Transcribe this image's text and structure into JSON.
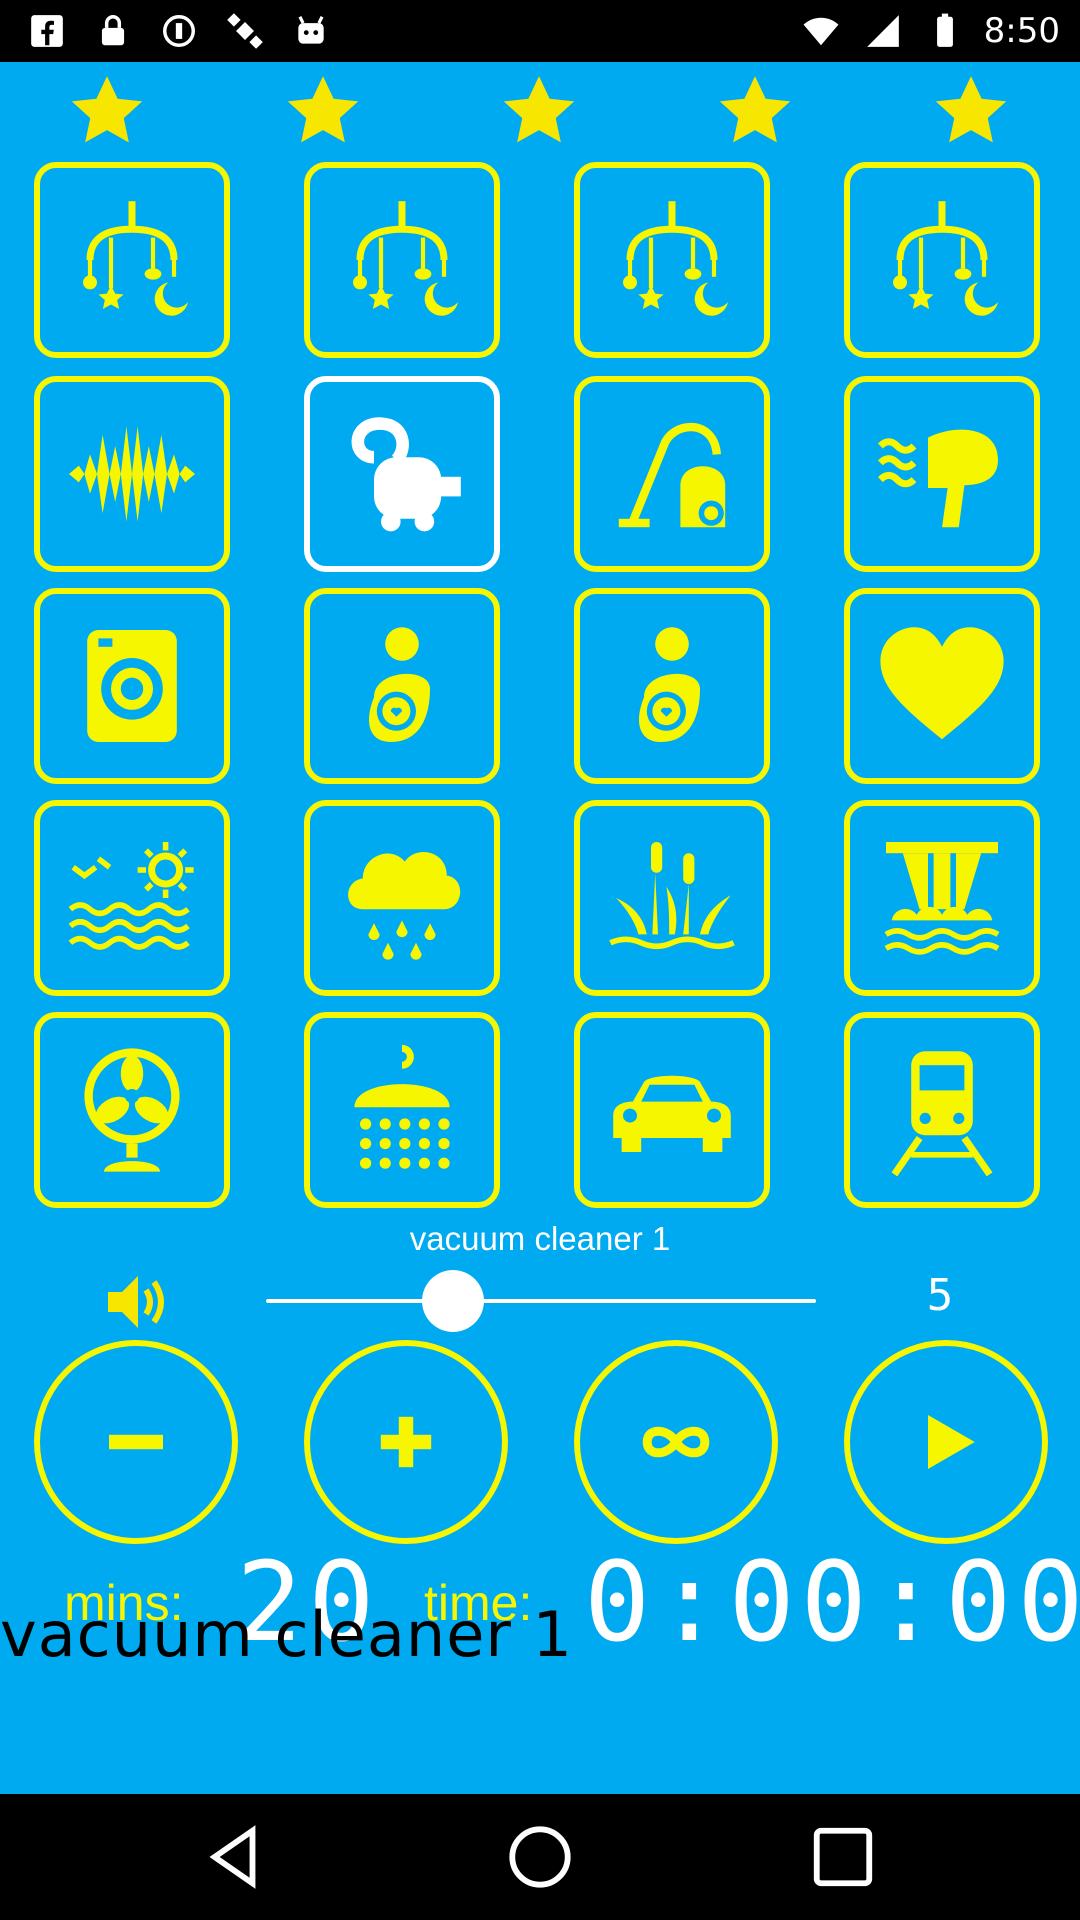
{
  "status_bar": {
    "time": "8:50",
    "icons": [
      "facebook-icon",
      "lock-icon",
      "sync-icon",
      "satellite-icon",
      "android-icon"
    ],
    "right_icons": [
      "wifi-icon",
      "signal-icon",
      "battery-icon"
    ]
  },
  "rating": {
    "stars": 5,
    "filled": 5
  },
  "sounds": [
    {
      "name": "mobile-1",
      "icon": "baby-mobile-icon"
    },
    {
      "name": "mobile-2",
      "icon": "baby-mobile-icon"
    },
    {
      "name": "mobile-3",
      "icon": "baby-mobile-icon"
    },
    {
      "name": "mobile-4",
      "icon": "baby-mobile-icon"
    },
    {
      "name": "white-noise",
      "icon": "sound-wave-icon"
    },
    {
      "name": "vacuum-cleaner-1",
      "icon": "vacuum-cleaner-icon",
      "selected": true
    },
    {
      "name": "vacuum-cleaner-2",
      "icon": "canister-vacuum-icon"
    },
    {
      "name": "hair-dryer",
      "icon": "hair-dryer-icon"
    },
    {
      "name": "washing-machine",
      "icon": "washing-machine-icon"
    },
    {
      "name": "mother-baby-1",
      "icon": "mother-baby-icon"
    },
    {
      "name": "mother-baby-2",
      "icon": "mother-baby-icon"
    },
    {
      "name": "heartbeat",
      "icon": "heart-icon"
    },
    {
      "name": "sea-sun",
      "icon": "sea-sun-icon"
    },
    {
      "name": "rain",
      "icon": "rain-cloud-icon"
    },
    {
      "name": "swamp",
      "icon": "reeds-icon"
    },
    {
      "name": "waterfall",
      "icon": "waterfall-icon"
    },
    {
      "name": "fan",
      "icon": "fan-icon"
    },
    {
      "name": "shower",
      "icon": "shower-icon"
    },
    {
      "name": "car",
      "icon": "car-icon"
    },
    {
      "name": "train",
      "icon": "train-icon"
    }
  ],
  "player": {
    "sound_title": "vacuum cleaner 1",
    "volume_icon": "volume-icon",
    "volume_value": "5",
    "volume_fraction": 0.34,
    "buttons": [
      "minus-icon",
      "plus-icon",
      "infinity-icon",
      "play-icon"
    ]
  },
  "timer": {
    "mins_label": "mins:",
    "mins_value": "20",
    "time_label": "time:",
    "time_value": "0:00:00"
  },
  "overlay_caption": "vacuum cleaner 1",
  "colors": {
    "background": "#00aaf0",
    "accent": "#f6f600",
    "white": "#ffffff"
  },
  "nav": [
    "back-icon",
    "home-icon",
    "recents-icon"
  ]
}
